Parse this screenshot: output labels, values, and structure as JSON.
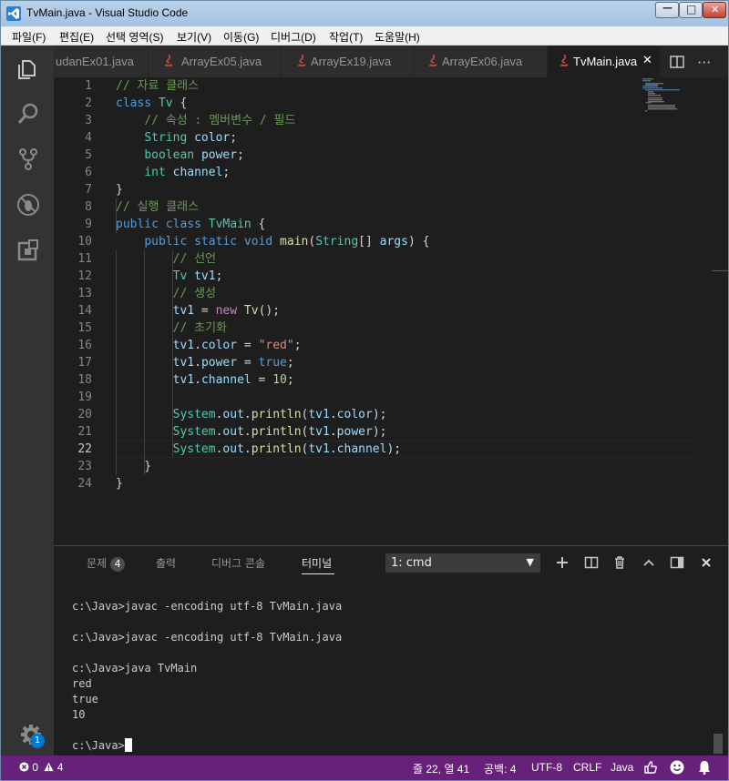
{
  "window": {
    "title": "TvMain.java - Visual Studio Code",
    "min_glyph": "—",
    "max_glyph": "□",
    "close_glyph": "✕"
  },
  "menu": [
    "파일(F)",
    "편집(E)",
    "선택 영역(S)",
    "보기(V)",
    "이동(G)",
    "디버그(D)",
    "작업(T)",
    "도움말(H)"
  ],
  "tabs": [
    {
      "label": "udanEx01.java",
      "active": false
    },
    {
      "label": "ArrayEx05.java",
      "active": false
    },
    {
      "label": "ArrayEx19.java",
      "active": false
    },
    {
      "label": "ArrayEx06.java",
      "active": false
    },
    {
      "label": "TvMain.java",
      "active": true
    }
  ],
  "tab_close_glyph": "✕",
  "more_glyph": "···",
  "editor": {
    "current_line": 22,
    "line_numbers": [
      "1",
      "2",
      "3",
      "4",
      "5",
      "6",
      "7",
      "8",
      "9",
      "10",
      "11",
      "12",
      "13",
      "14",
      "15",
      "16",
      "17",
      "18",
      "19",
      "20",
      "21",
      "22",
      "23",
      "24"
    ]
  },
  "panel": {
    "tabs": [
      "문제",
      "출력",
      "디버그 콘솔",
      "터미널"
    ],
    "problem_count": "4",
    "terminal_select": "1: cmd",
    "select_arrow": "▼",
    "terminal_lines": [
      "c:\\Java>javac -encoding utf-8 TvMain.java",
      "",
      "c:\\Java>javac -encoding utf-8 TvMain.java",
      "",
      "c:\\Java>java TvMain",
      "red",
      "true",
      "10",
      "",
      "c:\\Java>"
    ]
  },
  "activity": {
    "settings_badge": "1"
  },
  "status": {
    "errors": "0",
    "warnings": "4",
    "position": "줄 22, 열 41",
    "spaces": "공백: 4",
    "encoding": "UTF-8",
    "eol": "CRLF",
    "language": "Java"
  },
  "colors": {
    "status_bg": "#68217a",
    "accent": "#007acc",
    "editor_bg": "#1e1e1e"
  }
}
